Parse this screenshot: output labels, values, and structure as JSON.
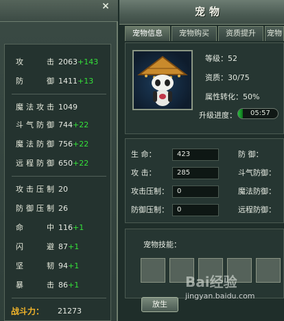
{
  "character": {
    "close": "×",
    "stats": [
      {
        "label": "攻击",
        "value": "2063",
        "bonus": "+143"
      },
      {
        "label": "防御",
        "value": "1411",
        "bonus": "+13"
      },
      {
        "label": "魔法攻击",
        "value": "1049",
        "bonus": ""
      },
      {
        "label": "斗气防御",
        "value": "744",
        "bonus": "+22"
      },
      {
        "label": "魔法防御",
        "value": "756",
        "bonus": "+22"
      },
      {
        "label": "远程防御",
        "value": "650",
        "bonus": "+22"
      },
      {
        "label": "攻击压制",
        "value": "20",
        "bonus": ""
      },
      {
        "label": "防御压制",
        "value": "26",
        "bonus": ""
      },
      {
        "label": "命中",
        "value": "116",
        "bonus": "+1"
      },
      {
        "label": "闪避",
        "value": "87",
        "bonus": "+1"
      },
      {
        "label": "坚韧",
        "value": "94",
        "bonus": "+1"
      },
      {
        "label": "暴击",
        "value": "86",
        "bonus": "+1"
      }
    ],
    "power_label": "战斗力：",
    "power_value": "21273"
  },
  "pet": {
    "title": "宠物",
    "tabs": [
      "宠物信息",
      "宠物购买",
      "资质提升",
      "宠物"
    ],
    "level": "等级：52",
    "aptitude": "资质：30/75",
    "conversion": "属性转化：50%",
    "exp_label": "升级进度：",
    "exp_value": "05:57",
    "exp_fraction": 0.12,
    "attrs_left": [
      {
        "label": "生    命：",
        "value": "423"
      },
      {
        "label": "攻    击：",
        "value": "285"
      },
      {
        "label": "攻击压制：",
        "value": "0"
      },
      {
        "label": "防御压制：",
        "value": "0"
      }
    ],
    "attrs_right": [
      "防    御：",
      "斗气防御：",
      "魔法防御：",
      "远程防御："
    ],
    "skills_label": "宠物技能：",
    "release_label": "放生"
  },
  "watermark": {
    "logo": "Bai经验",
    "url": "jingyan.baidu.com"
  }
}
